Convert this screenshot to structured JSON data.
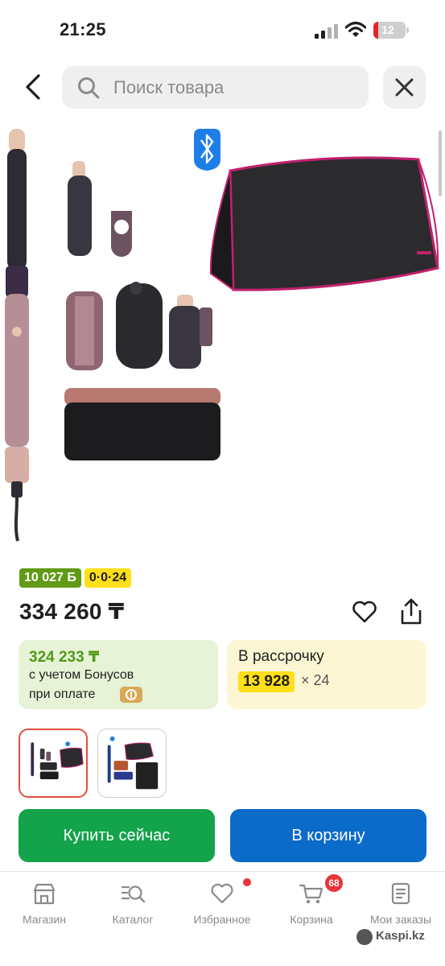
{
  "status_bar": {
    "time": "21:25",
    "battery_level": "12",
    "battery_color": "#e0252b"
  },
  "header": {
    "back_icon": "chevron-left-icon",
    "search_icon": "search-icon",
    "search_placeholder": "Поиск товара",
    "close_icon": "close-icon"
  },
  "product": {
    "image_icon": "product-photo-hair-styler-set",
    "bluetooth_icon": "bluetooth-icon",
    "bonus_badge": "10 027 Б",
    "installment_badge": "0·0·24",
    "price": "334 260 ₸",
    "favorite_icon": "heart-icon",
    "share_icon": "share-icon"
  },
  "bonus_card": {
    "price": "324 233 ₸",
    "line1": "с учетом Бонусов",
    "line2": "при оплате",
    "accent": "#4f9a17"
  },
  "installment_card": {
    "title": "В рассрочку",
    "monthly": "13 928",
    "months": "× 24"
  },
  "thumbnails": [
    {
      "label": "product-thumbnail-1",
      "selected": true
    },
    {
      "label": "product-thumbnail-2",
      "selected": false
    }
  ],
  "actions": {
    "buy_now": "Купить сейчас",
    "add_to_cart": "В корзину",
    "buy_color": "#13a34a",
    "cart_color": "#0b6bc8"
  },
  "bottom_nav": {
    "items": [
      {
        "label": "Магазин",
        "icon": "store-icon"
      },
      {
        "label": "Каталог",
        "icon": "catalog-search-icon"
      },
      {
        "label": "Избранное",
        "icon": "heart-icon"
      },
      {
        "label": "Корзина",
        "icon": "cart-icon"
      },
      {
        "label": "Мои заказы",
        "icon": "orders-icon"
      }
    ],
    "cart_count": "68"
  },
  "watermark": "Kaspi.kz"
}
